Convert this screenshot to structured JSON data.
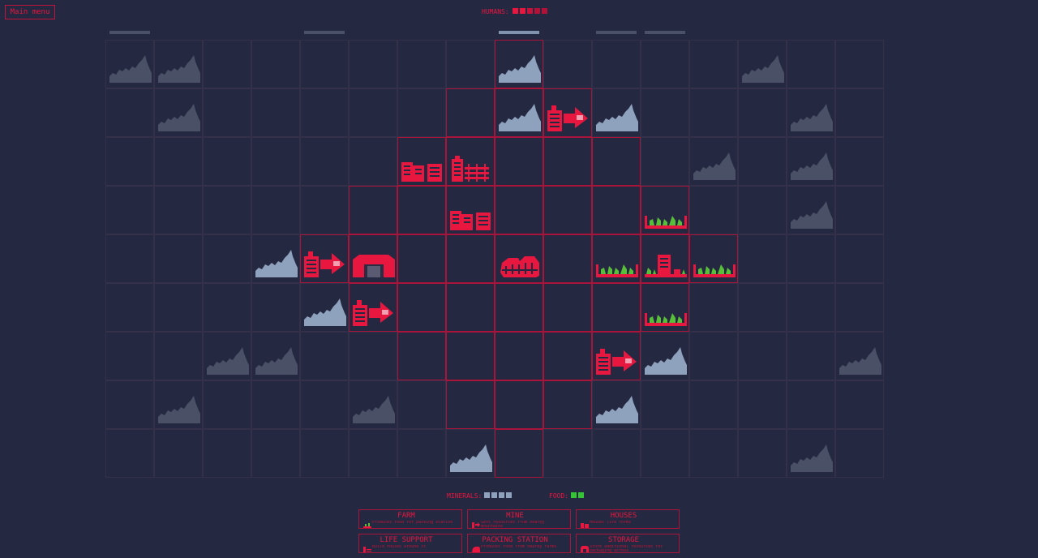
{
  "main_menu_label": "Main menu",
  "hud": {
    "humans_label": "HUMANS:",
    "humans_pips": [
      "#e8173f",
      "#e8173f",
      "#c4133a",
      "#b01238",
      "#b01238"
    ],
    "minerals_label": "MINERALS:",
    "minerals_pips": [
      "#8ea1bd",
      "#8ea1bd",
      "#8ea1bd",
      "#8ea1bd"
    ],
    "food_label": "FOOD:",
    "food_pips": [
      "#35c435",
      "#35c435"
    ]
  },
  "colors": {
    "accent": "#e8173f",
    "background": "#252841",
    "mineral_bright": "#8ea1bd",
    "mineral_dim": "#4a5166",
    "crop_green": "#58c038"
  },
  "top_markers": [
    {
      "col": 0,
      "bright": false
    },
    {
      "col": 4,
      "bright": false
    },
    {
      "col": 8,
      "bright": true
    },
    {
      "col": 10,
      "bright": false
    },
    {
      "col": 11,
      "bright": false
    }
  ],
  "active_cells": [
    [
      8,
      0
    ],
    [
      7,
      1
    ],
    [
      8,
      1
    ],
    [
      9,
      1
    ],
    [
      6,
      2
    ],
    [
      7,
      2
    ],
    [
      8,
      2
    ],
    [
      9,
      2
    ],
    [
      10,
      2
    ],
    [
      5,
      3
    ],
    [
      6,
      3
    ],
    [
      7,
      3
    ],
    [
      8,
      3
    ],
    [
      9,
      3
    ],
    [
      10,
      3
    ],
    [
      11,
      3
    ],
    [
      4,
      4
    ],
    [
      5,
      4
    ],
    [
      6,
      4
    ],
    [
      7,
      4
    ],
    [
      8,
      4
    ],
    [
      9,
      4
    ],
    [
      10,
      4
    ],
    [
      11,
      4
    ],
    [
      12,
      4
    ],
    [
      5,
      5
    ],
    [
      6,
      5
    ],
    [
      7,
      5
    ],
    [
      8,
      5
    ],
    [
      9,
      5
    ],
    [
      10,
      5
    ],
    [
      11,
      5
    ],
    [
      6,
      6
    ],
    [
      7,
      6
    ],
    [
      8,
      6
    ],
    [
      9,
      6
    ],
    [
      10,
      6
    ],
    [
      7,
      7
    ],
    [
      8,
      7
    ],
    [
      9,
      7
    ],
    [
      8,
      8
    ]
  ],
  "tiles": [
    {
      "col": 0,
      "row": 0,
      "kind": "mountain-dim"
    },
    {
      "col": 1,
      "row": 0,
      "kind": "mountain-dim"
    },
    {
      "col": 8,
      "row": 0,
      "kind": "mountain"
    },
    {
      "col": 13,
      "row": 0,
      "kind": "mountain-dim"
    },
    {
      "col": 1,
      "row": 1,
      "kind": "mountain-dim"
    },
    {
      "col": 8,
      "row": 1,
      "kind": "mountain"
    },
    {
      "col": 9,
      "row": 1,
      "kind": "mine"
    },
    {
      "col": 10,
      "row": 1,
      "kind": "mountain"
    },
    {
      "col": 14,
      "row": 1,
      "kind": "mountain-dim"
    },
    {
      "col": 6,
      "row": 2,
      "kind": "houses"
    },
    {
      "col": 7,
      "row": 2,
      "kind": "life-support"
    },
    {
      "col": 12,
      "row": 2,
      "kind": "mountain-dim"
    },
    {
      "col": 14,
      "row": 2,
      "kind": "mountain-dim"
    },
    {
      "col": 7,
      "row": 3,
      "kind": "houses"
    },
    {
      "col": 11,
      "row": 3,
      "kind": "farm"
    },
    {
      "col": 14,
      "row": 3,
      "kind": "mountain-dim"
    },
    {
      "col": 3,
      "row": 4,
      "kind": "mountain"
    },
    {
      "col": 4,
      "row": 4,
      "kind": "mine"
    },
    {
      "col": 5,
      "row": 4,
      "kind": "storage"
    },
    {
      "col": 8,
      "row": 4,
      "kind": "packing"
    },
    {
      "col": 10,
      "row": 4,
      "kind": "farm"
    },
    {
      "col": 11,
      "row": 4,
      "kind": "farm-house"
    },
    {
      "col": 12,
      "row": 4,
      "kind": "farm"
    },
    {
      "col": 4,
      "row": 5,
      "kind": "mountain"
    },
    {
      "col": 5,
      "row": 5,
      "kind": "mine"
    },
    {
      "col": 11,
      "row": 5,
      "kind": "farm"
    },
    {
      "col": 2,
      "row": 6,
      "kind": "mountain-dim"
    },
    {
      "col": 3,
      "row": 6,
      "kind": "mountain-dim"
    },
    {
      "col": 10,
      "row": 6,
      "kind": "mine"
    },
    {
      "col": 11,
      "row": 6,
      "kind": "mountain"
    },
    {
      "col": 15,
      "row": 6,
      "kind": "mountain-dim"
    },
    {
      "col": 1,
      "row": 7,
      "kind": "mountain-dim"
    },
    {
      "col": 5,
      "row": 7,
      "kind": "mountain-dim"
    },
    {
      "col": 10,
      "row": 7,
      "kind": "mountain"
    },
    {
      "col": 7,
      "row": 8,
      "kind": "mountain"
    },
    {
      "col": 14,
      "row": 8,
      "kind": "mountain-dim"
    }
  ],
  "buildings": [
    {
      "title": "FARM",
      "desc": "Produces food for packing station",
      "icon": "farm"
    },
    {
      "title": "MINE",
      "desc": "Gets resources from nearby mountains",
      "icon": "mine"
    },
    {
      "title": "HOUSES",
      "desc": "Houses life forms",
      "icon": "houses"
    },
    {
      "title": "LIFE SUPPORT",
      "desc": "Build houses around it",
      "icon": "life-support"
    },
    {
      "title": "PACKING STATION",
      "desc": "Produces food from nearby farms",
      "icon": "packing"
    },
    {
      "title": "STORAGE",
      "desc": "Store additional resources for packaging across",
      "icon": "storage"
    }
  ]
}
